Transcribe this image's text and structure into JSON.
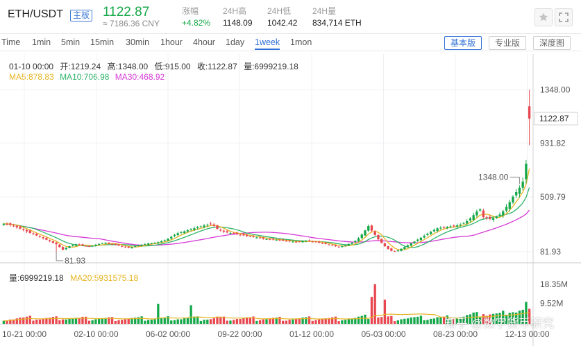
{
  "header": {
    "pair": "ETH/USDT",
    "badge": "主板",
    "price": "1122.87",
    "price_cny": "≈ 7186.36 CNY",
    "stats": [
      {
        "label": "涨幅",
        "value": "+4.82%",
        "up": true
      },
      {
        "label": "24H高",
        "value": "1148.09",
        "up": false
      },
      {
        "label": "24H低",
        "value": "1042.42",
        "up": false
      },
      {
        "label": "24H量",
        "value": "834,714 ETH",
        "up": false
      }
    ],
    "icons": [
      "star-icon",
      "fullscreen-icon"
    ]
  },
  "toolbar": {
    "timeframes": [
      "Time",
      "1min",
      "5min",
      "15min",
      "30min",
      "1hour",
      "4hour",
      "1day",
      "1week",
      "1mon"
    ],
    "active_timeframe": "1week",
    "views": [
      "基本版",
      "专业版",
      "深度图"
    ],
    "active_view": "基本版"
  },
  "info": {
    "date": "01-10 00:00",
    "open": "开:1219.24",
    "high": "高:1348.00",
    "low": "低:915.00",
    "close": "收:1122.87",
    "volume": "量:6999219.18",
    "ma5": "MA5:878.83",
    "ma10": "MA10:706.98",
    "ma30": "MA30:468.92",
    "vol_label": "量:6999219.18",
    "ma20_vol": "MA20:5931575.18"
  },
  "colors": {
    "up": "#15a84a",
    "down": "#e8474f",
    "ma5": "#e6b422",
    "ma10": "#2fb36a",
    "ma30": "#d63ad6",
    "accent": "#2f6fd6"
  },
  "watermark": "知乎 @数字货币研究",
  "chart_data": {
    "type": "candlestick",
    "price_axis": {
      "ticks": [
        81.93,
        509.79,
        931.82,
        1348.0
      ],
      "tick_labels": [
        "81.93",
        "509.79",
        "931.82",
        "1348.00"
      ],
      "current_label": "1122.87",
      "ylim": [
        0,
        1400
      ]
    },
    "volume_axis": {
      "ticks": [
        9.52,
        18.35
      ],
      "tick_labels": [
        "9.52M",
        "18.35M"
      ],
      "ylim": [
        0,
        19
      ]
    },
    "x_ticks": [
      "10-21 00:00",
      "02-10 00:00",
      "06-02 00:00",
      "09-22 00:00",
      "01-12 00:00",
      "05-03 00:00",
      "08-23 00:00",
      "12-13 00:00"
    ],
    "annotations": [
      {
        "text": "81.93",
        "kind": "low",
        "index": 16
      },
      {
        "text": "1348.00",
        "kind": "high",
        "index": 157
      }
    ],
    "candles_close": [
      300,
      298,
      292,
      283,
      272,
      262,
      250,
      240,
      228,
      220,
      208,
      196,
      186,
      175,
      163,
      150,
      140,
      118,
      96,
      112,
      124,
      132,
      140,
      137,
      130,
      126,
      122,
      128,
      135,
      142,
      148,
      150,
      146,
      141,
      136,
      129,
      121,
      116,
      112,
      118,
      124,
      130,
      136,
      141,
      146,
      148,
      151,
      156,
      163,
      171,
      183,
      198,
      214,
      226,
      234,
      241,
      249,
      258,
      265,
      272,
      279,
      286,
      292,
      298,
      284,
      260,
      248,
      238,
      232,
      228,
      224,
      219,
      214,
      209,
      204,
      201,
      198,
      193,
      188,
      183,
      180,
      178,
      176,
      174,
      171,
      168,
      166,
      163,
      160,
      158,
      160,
      163,
      166,
      164,
      160,
      156,
      152,
      148,
      142,
      136,
      130,
      124,
      118,
      124,
      132,
      142,
      152,
      166,
      186,
      216,
      248,
      282,
      246,
      212,
      178,
      150,
      124,
      103,
      88,
      84,
      92,
      104,
      118,
      132,
      147,
      161,
      176,
      191,
      206,
      222,
      238,
      252,
      264,
      268,
      271,
      275,
      279,
      283,
      287,
      294,
      306,
      321,
      342,
      368,
      396,
      412,
      352,
      346,
      337,
      344,
      354,
      372,
      398,
      432,
      470,
      512,
      548,
      582,
      630,
      770,
      1122.87
    ],
    "close_note": "weekly closes in USDT, last value 1122.87",
    "ma_legend": [
      "MA5",
      "MA10",
      "MA30"
    ]
  }
}
